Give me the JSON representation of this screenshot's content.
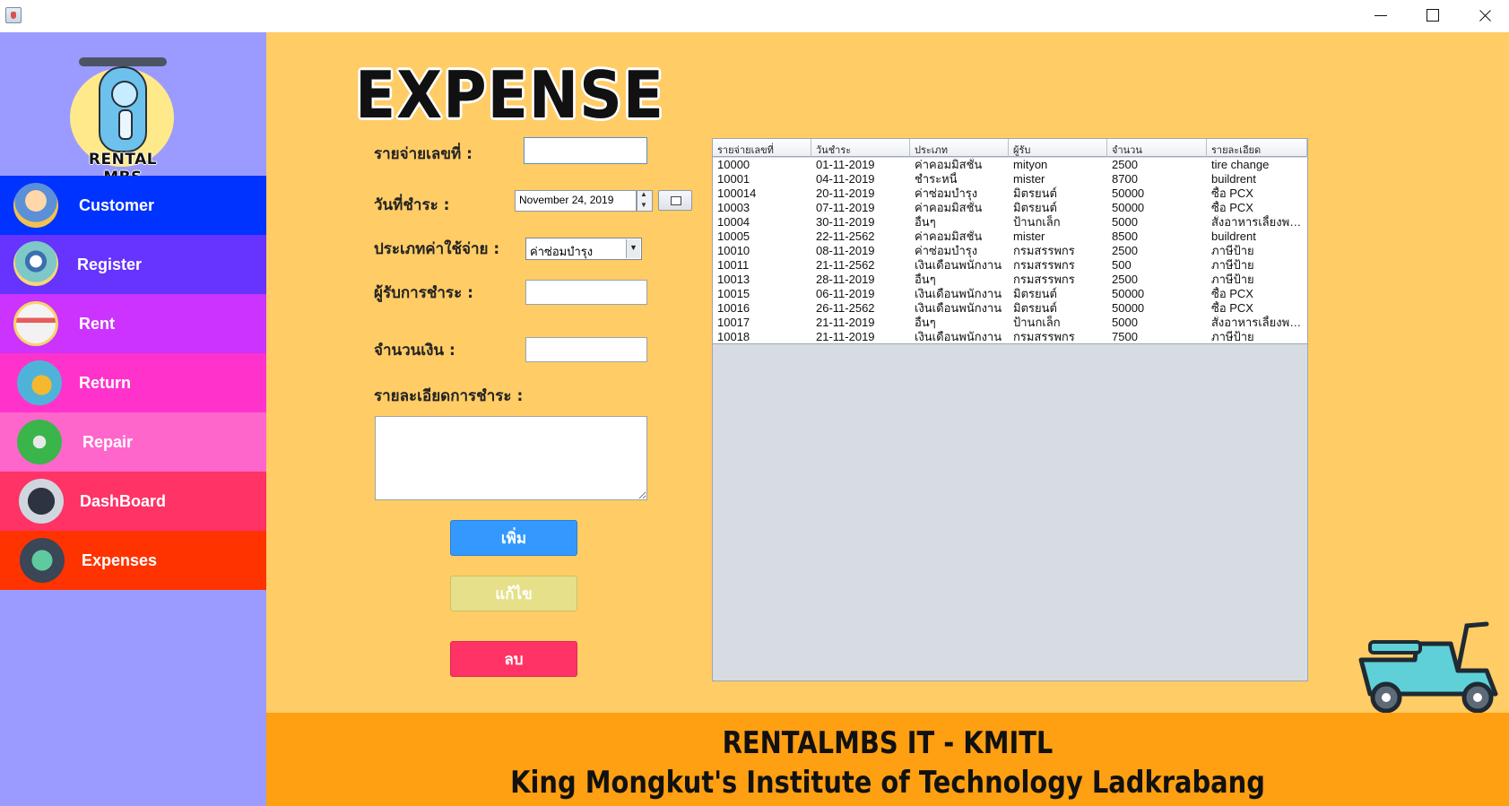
{
  "window": {
    "app_icon": "java-app-icon"
  },
  "sidebar": {
    "logo_text": "RENTAL MBS",
    "items": [
      {
        "label": "Customer",
        "icon": "customer-group-icon",
        "color": "#0033ff"
      },
      {
        "label": "Register",
        "icon": "register-van-icon",
        "color": "#6633ff"
      },
      {
        "label": "Rent",
        "icon": "rent-cashier-icon",
        "color": "#cc33ff"
      },
      {
        "label": "Return",
        "icon": "return-scooter-icon",
        "color": "#ff33cc"
      },
      {
        "label": "Repair",
        "icon": "repair-tools-icon",
        "color": "#ff66cc"
      },
      {
        "label": "DashBoard",
        "icon": "dashboard-chart-icon",
        "color": "#ff3366"
      },
      {
        "label": "Expenses",
        "icon": "expenses-icon",
        "color": "#ff3300"
      }
    ]
  },
  "page": {
    "title": "EXPENSE"
  },
  "form": {
    "expense_no_label": "รายจ่ายเลขที่ :",
    "pay_date_label": "วันที่ชำระ :",
    "pay_date_value": "November 24, 2019",
    "type_label": "ประเภทค่าใช้จ่าย :",
    "type_value": "ค่าซ่อมบำรุง",
    "payee_label": "ผู้รับการชำระ :",
    "amount_label": "จำนวนเงิน :",
    "detail_label": "รายละเอียดการชำระ :",
    "add_button": "เพิ่ม",
    "edit_button": "แก้ไข",
    "delete_button": "ลบ"
  },
  "table": {
    "columns": [
      "รายจ่ายเลขที่",
      "วันชำระ",
      "ประเภท",
      "ผู้รับ",
      "จำนวน",
      "รายละเอียด"
    ],
    "rows": [
      [
        "10000",
        "01-11-2019",
        "ค่าคอมมิสชั่น",
        "mityon",
        "2500",
        "tire change"
      ],
      [
        "10001",
        "04-11-2019",
        "ชำระหนี้",
        "mister",
        "8700",
        "buildrent"
      ],
      [
        "100014",
        "20-11-2019",
        "ค่าซ่อมบำรุง",
        "มิตรยนต์",
        "50000",
        "ซื้อ PCX"
      ],
      [
        "10003",
        "07-11-2019",
        "ค่าคอมมิสชั่น",
        "มิตรยนต์",
        "50000",
        "ซื้อ PCX"
      ],
      [
        "10004",
        "30-11-2019",
        "อื่นๆ",
        "ป้านกเล็ก",
        "5000",
        "สั่งอาหารเลี้ยงพนักงาน"
      ],
      [
        "10005",
        "22-11-2562",
        "ค่าคอมมิสชั่น",
        "mister",
        "8500",
        "buildrent"
      ],
      [
        "10010",
        "08-11-2019",
        "ค่าซ่อมบำรุง",
        "กรมสรรพกร",
        "2500",
        "ภาษีป้าย"
      ],
      [
        "10011",
        "21-11-2562",
        "เงินเดือนพนักงาน",
        "กรมสรรพกร",
        "500",
        "ภาษีป้าย"
      ],
      [
        "10013",
        "28-11-2019",
        "อื่นๆ",
        "กรมสรรพกร",
        "2500",
        "ภาษีป้าย"
      ],
      [
        "10015",
        "06-11-2019",
        "เงินเดือนพนักงาน",
        "มิตรยนต์",
        "50000",
        "ซื้อ PCX"
      ],
      [
        "10016",
        "26-11-2562",
        "เงินเดือนพนักงาน",
        "มิตรยนต์",
        "50000",
        "ซื้อ PCX"
      ],
      [
        "10017",
        "21-11-2019",
        "อื่นๆ",
        "ป้านกเล็ก",
        "5000",
        "สั่งอาหารเลี้ยงพนักงาน"
      ],
      [
        "10018",
        "21-11-2019",
        "เงินเดือนพนักงาน",
        "กรมสรรพกร",
        "7500",
        "ภาษีป้าย"
      ]
    ]
  },
  "footer": {
    "line1": "RENTALMBS IT - KMITL",
    "line2": "King Mongkut's Institute of  Technology Ladkrabang"
  },
  "colors": {
    "sidebar_bg": "#9b9bff",
    "main_bg": "#ffcc66",
    "footer_bg": "#ff9f12",
    "add_button": "#3399ff",
    "edit_button": "#e6e08a",
    "delete_button": "#ff3366"
  }
}
